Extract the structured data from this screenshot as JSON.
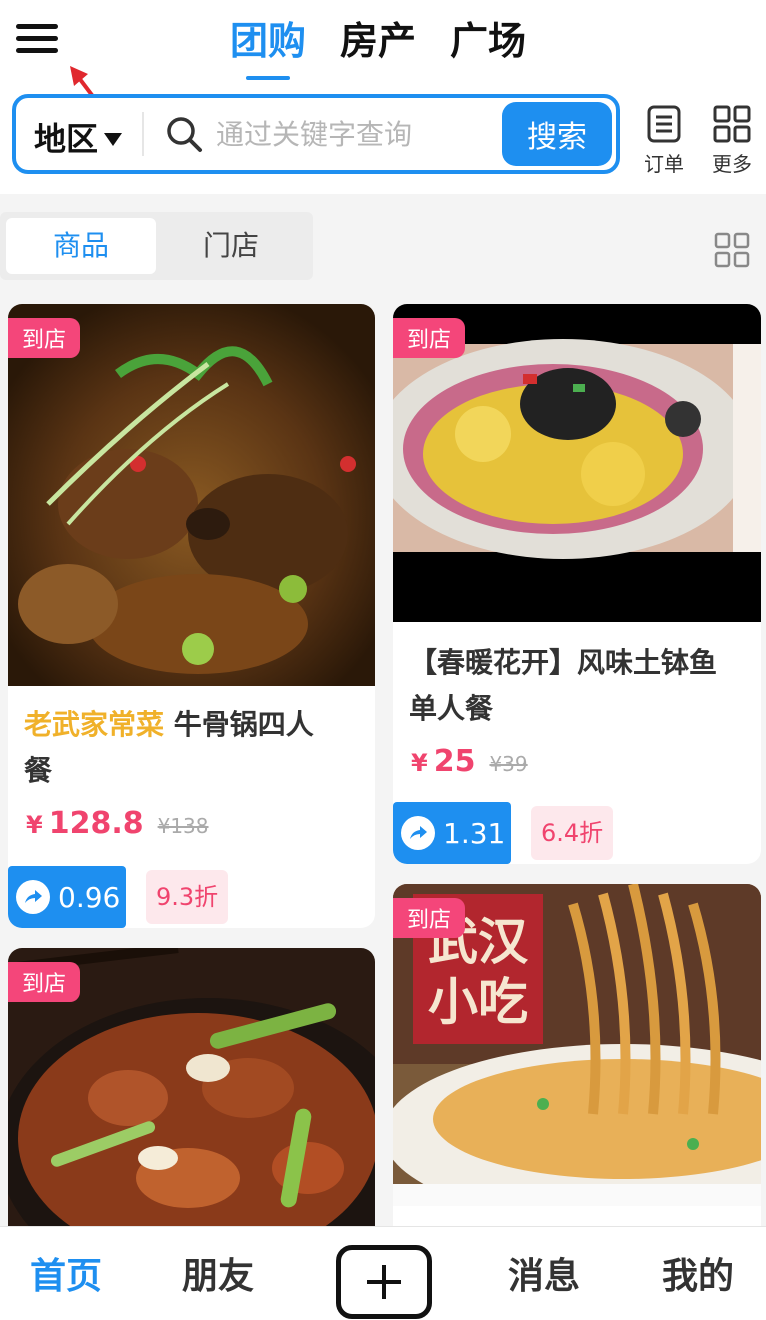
{
  "header": {
    "tabs": [
      {
        "label": "团购",
        "active": true
      },
      {
        "label": "房产",
        "active": false
      },
      {
        "label": "广场",
        "active": false
      }
    ]
  },
  "search": {
    "region_label": "地区",
    "placeholder": "通过关键字查询",
    "button_label": "搜索"
  },
  "tools": {
    "order_label": "订单",
    "more_label": "更多"
  },
  "category_tabs": {
    "items": [
      "商品",
      "门店"
    ],
    "active": "商品"
  },
  "products": [
    {
      "badge": "到店",
      "shop": "老武家常菜",
      "title_line1": " 牛骨锅四人",
      "title_line2": "餐",
      "price_symbol": "¥",
      "price": "128.8",
      "old_price": "¥138",
      "share": "0.96",
      "discount": "9.3折"
    },
    {
      "badge": "到店",
      "title_line1": "【春暖花开】风味土钵鱼",
      "title_line2": "单人餐",
      "price_symbol": "¥",
      "price": "25",
      "old_price": "¥39",
      "share": "1.31",
      "discount": "6.4折"
    },
    {
      "badge": "到店"
    },
    {
      "badge": "到店",
      "image_text": "武汉小吃"
    }
  ],
  "bottom_nav": {
    "home": "首页",
    "friends": "朋友",
    "messages": "消息",
    "me": "我的",
    "active": "首页"
  },
  "colors": {
    "accent": "#1e8ff0",
    "price": "#f0446e",
    "shop_name": "#f0b12a",
    "badge": "#f4467a"
  }
}
